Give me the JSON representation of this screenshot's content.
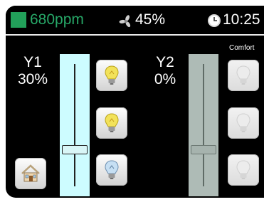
{
  "status": {
    "co2": "680ppm",
    "humidity": "45%",
    "time": "10:25",
    "co2_color": "#27a868"
  },
  "zones": [
    {
      "name": "Y1",
      "level": "30%",
      "slider_level_percent": 30,
      "active": true,
      "track_color": "#cdfcff",
      "lamp_buttons": [
        "bulb-yellow-icon",
        "bulb-yellow-icon",
        "bulb-blue-icon"
      ]
    },
    {
      "name": "Y2",
      "level": "0%",
      "slider_level_percent": 30,
      "active": false,
      "track_color": "#aebbb6",
      "mode": "Comfort",
      "lamp_buttons": [
        "bulb-grey-icon",
        "bulb-grey-icon",
        "bulb-grey-icon"
      ]
    }
  ],
  "home_button_icon": "house-icon"
}
